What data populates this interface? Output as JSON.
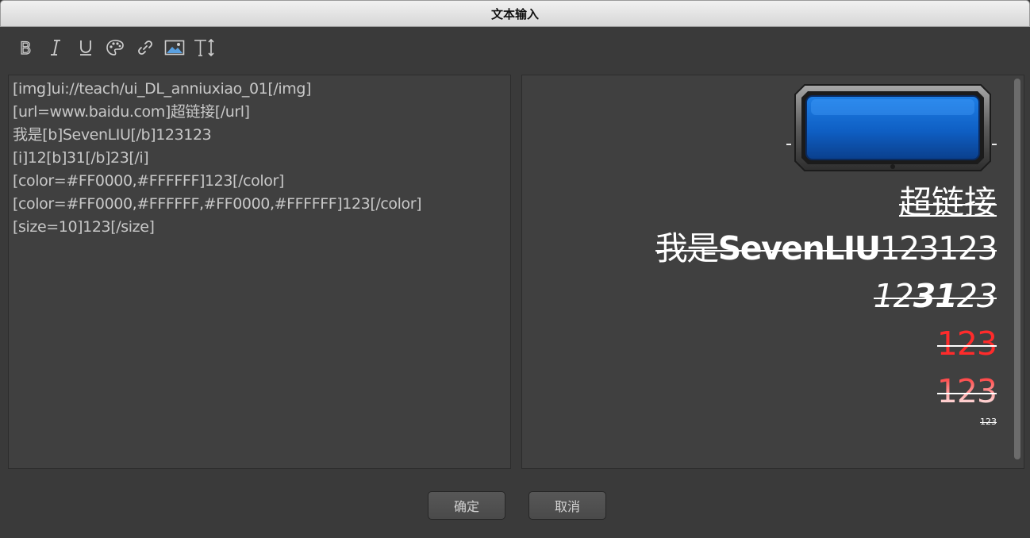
{
  "window": {
    "title": "文本输入"
  },
  "toolbar": {
    "buttons": [
      {
        "name": "bold-icon",
        "glyph": "B"
      },
      {
        "name": "italic-icon",
        "glyph": "I"
      },
      {
        "name": "underline-icon",
        "glyph": "U"
      },
      {
        "name": "color-palette-icon"
      },
      {
        "name": "link-icon"
      },
      {
        "name": "image-icon"
      },
      {
        "name": "font-size-icon",
        "glyph": "T↕"
      }
    ]
  },
  "editor": {
    "lines": [
      "[img]ui://teach/ui_DL_anniuxiao_01[/img]",
      "[url=www.baidu.com]超链接[/url]",
      "我是[b]SevenLIU[/b]123123",
      "[i]12[b]31[/b]23[/i]",
      "[color=#FF0000,#FFFFFF]123[/color]",
      "[color=#FF0000,#FFFFFF,#FF0000,#FFFFFF]123[/color]",
      "[size=10]123[/size]"
    ]
  },
  "preview": {
    "image_name": "ui_DL_anniuxiao_01",
    "link_text": "超链接",
    "line3": {
      "prefix": "我是",
      "bold": "SevenLIU",
      "suffix": "123123"
    },
    "line4": {
      "prefix": "12",
      "bold": "31",
      "suffix": "23"
    },
    "line5": {
      "text": "123",
      "color": "#FF0000",
      "gradient_to": "#FFFFFF"
    },
    "line6": {
      "text": "123",
      "colors": [
        "#FF0000",
        "#FFFFFF",
        "#FF0000",
        "#FFFFFF"
      ]
    },
    "line7": {
      "text": "123",
      "size": 10
    }
  },
  "footer": {
    "confirm_label": "确定",
    "cancel_label": "取消"
  },
  "colors": {
    "background": "#3a3a3a",
    "panel": "#404040",
    "text": "#c8c8c8",
    "accent_blue": "#1e78d8",
    "red": "#FF0000"
  }
}
